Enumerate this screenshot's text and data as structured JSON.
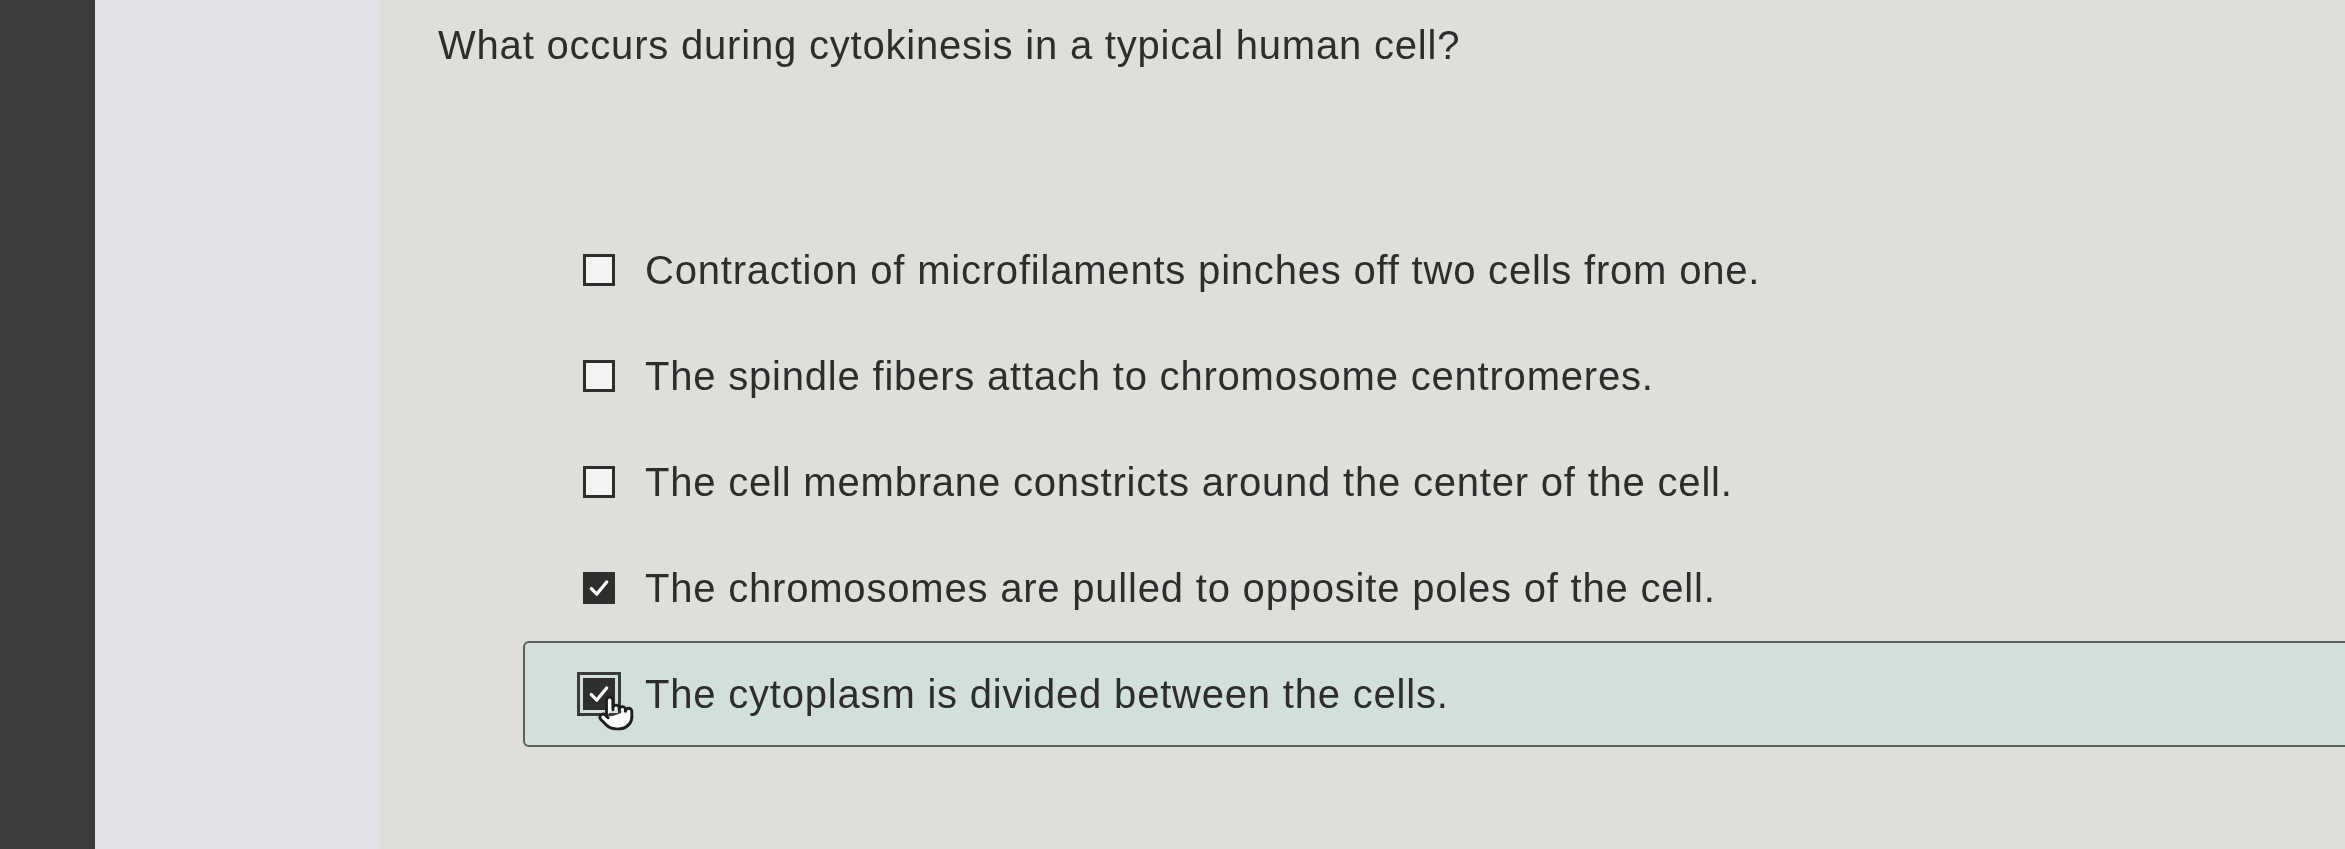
{
  "question": {
    "text": "What occurs during cytokinesis in a typical human cell?"
  },
  "options": [
    {
      "label": "Contraction of microfilaments pinches off two cells from one.",
      "checked": false,
      "highlighted": false
    },
    {
      "label": "The spindle fibers attach to chromosome centromeres.",
      "checked": false,
      "highlighted": false
    },
    {
      "label": "The cell membrane constricts around the center of the cell.",
      "checked": false,
      "highlighted": false
    },
    {
      "label": "The chromosomes are pulled to opposite poles of the cell.",
      "checked": true,
      "highlighted": false
    },
    {
      "label": "The cytoplasm is divided between the cells.",
      "checked": true,
      "highlighted": true
    }
  ]
}
